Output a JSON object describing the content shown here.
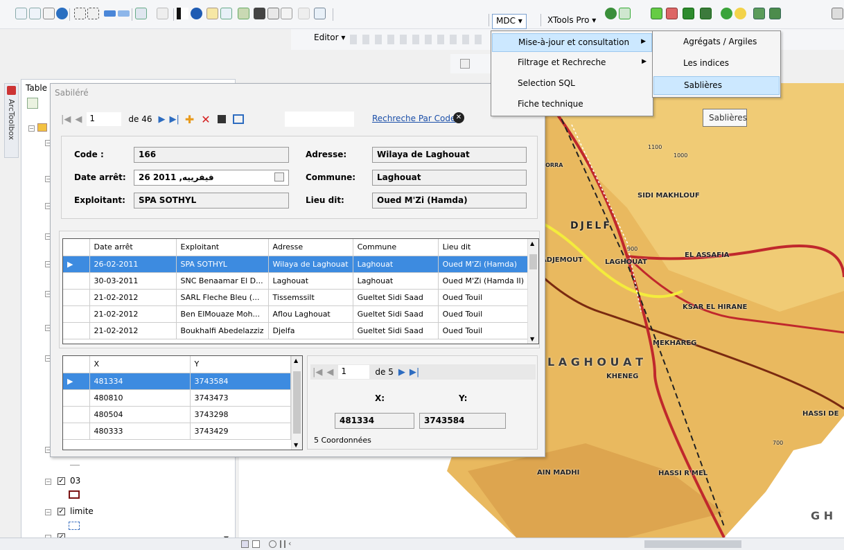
{
  "toolbar": {
    "mdc_label": "MDC ▾",
    "xtools_label": "XTools Pro ▾",
    "editor_label": "Editor ▾"
  },
  "menu": {
    "items": [
      {
        "label": "Mise-à-jour et consultation",
        "has_sub": true
      },
      {
        "label": "Filtrage et Rechreche",
        "has_sub": true
      },
      {
        "label": "Selection SQL",
        "has_sub": false
      },
      {
        "label": "Fiche technique",
        "has_sub": false
      }
    ],
    "submenu": [
      "Agrégats / Argiles",
      "Les indices",
      "Sablières"
    ],
    "tooltip": "Sablières"
  },
  "left": {
    "toolbox_label": "ArcToolbox",
    "toc_title": "Table",
    "layers": [
      {
        "name": "03"
      },
      {
        "name": "limite"
      },
      {
        "name": ""
      }
    ]
  },
  "dialog": {
    "title": "Sabiléré",
    "record": "1",
    "of_label": "de 46",
    "search_link": "Rechreche Par Code",
    "fields": {
      "code_label": "Code :",
      "code_value": "166",
      "date_label": "Date arrêt:",
      "date_value": "26 فيفرييه, 2011",
      "exploitant_label": "Exploitant:",
      "exploitant_value": "SPA SOTHYL",
      "adresse_label": "Adresse:",
      "adresse_value": "Wilaya de Laghouat",
      "commune_label": "Commune:",
      "commune_value": "Laghouat",
      "lieu_label": "Lieu dit:",
      "lieu_value": "Oued M'Zi (Hamda)"
    },
    "main_grid": {
      "headers": [
        "Date arrêt",
        "Exploitant",
        "Adresse",
        "Commune",
        "Lieu dit"
      ],
      "rows": [
        [
          "26-02-2011",
          "SPA SOTHYL",
          "Wilaya de Laghouat",
          "Laghouat",
          "Oued M'Zi (Hamda)"
        ],
        [
          "30-03-2011",
          "SNC Benaamar El D...",
          "Laghouat",
          "Laghouat",
          "Oued M'Zi (Hamda II)"
        ],
        [
          "21-02-2012",
          "SARL Fleche Bleu (...",
          "Tissemssilt",
          "Gueltet Sidi Saad",
          "Oued Touil"
        ],
        [
          "21-02-2012",
          "Ben ElMouaze Moh...",
          "Aflou Laghouat",
          "Gueltet Sidi Saad",
          "Oued Touil"
        ],
        [
          "21-02-2012",
          "Boukhalfi Abedelazziz",
          "Djelfa",
          "Gueltet Sidi Saad",
          "Oued Touil"
        ]
      ]
    },
    "coord_grid": {
      "headers": [
        "X",
        "Y"
      ],
      "rows": [
        [
          "481334",
          "3743584"
        ],
        [
          "480810",
          "3743473"
        ],
        [
          "480504",
          "3743298"
        ],
        [
          "480333",
          "3743429"
        ]
      ]
    },
    "coord_nav": {
      "record": "1",
      "of_label": "de 5"
    },
    "coord_labels": {
      "x": "X:",
      "y": "Y:",
      "x_value": "481334",
      "y_value": "3743584"
    },
    "coord_count": "5 Coordonnées"
  },
  "map": {
    "labels": [
      "DJELF",
      "SIDI MAKHLOUF",
      "EL ASSAFIA",
      "TADJEMOUT",
      "LAGHOUAT",
      "KSAR EL HIRANE",
      "MEKHAREG",
      "L A G H O U A T",
      "KHENEG",
      "HASSI DE",
      "AIN MADHI",
      "HASSI R'MEL",
      "G H",
      "1100",
      "1000",
      "900",
      "700",
      "BORRA"
    ]
  },
  "colors": {
    "selection": "#3d8be0",
    "menu_highlight": "#cce8ff",
    "link": "#1a4ea8",
    "map_land": "#e8b75c"
  }
}
